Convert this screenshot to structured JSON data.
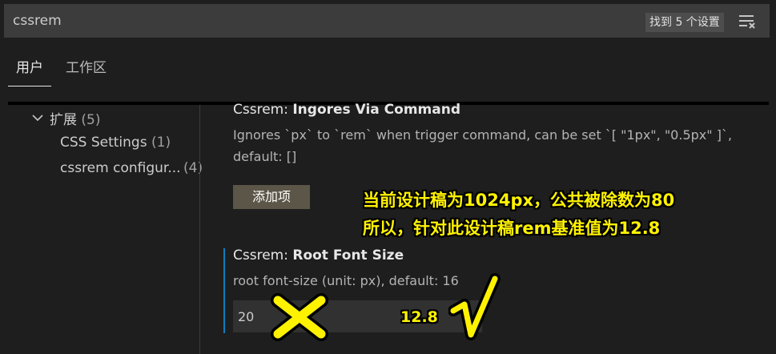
{
  "search": {
    "value": "cssrem",
    "result_badge": "找到 5 个设置",
    "filter_icon": "clear-filter-icon"
  },
  "tabs": [
    {
      "label": "用户",
      "active": true
    },
    {
      "label": "工作区",
      "active": false
    }
  ],
  "tree": {
    "group_label": "扩展",
    "group_count": "(5)",
    "items": [
      {
        "label": "CSS Settings",
        "count": "(1)"
      },
      {
        "label": "cssrem configur...",
        "count": "(4)"
      }
    ]
  },
  "settings": {
    "ingores": {
      "prefix": "Cssrem: ",
      "name": "Ingores Via Command",
      "desc_line1": "Ignores `px` to `rem` when trigger command, can be set `[ \"1px\", \"0.5px\" ]`,",
      "desc_line2": "default: []",
      "add_button": "添加项"
    },
    "root_font_size": {
      "prefix": "Cssrem: ",
      "name": "Root Font Size",
      "desc": "root font-size (unit: px), default: 16",
      "value": "20"
    }
  },
  "annotations": {
    "line1": "当前设计稿为1024px，公共被除数为80",
    "line2": "所以，针对此设计稿rem基准值为12.8",
    "correct_value": "12.8",
    "wrong_mark": "✕",
    "right_mark": "√"
  },
  "colors": {
    "background": "#1e1e1e",
    "accent_focus": "#0e7fc0",
    "annotation": "#fff200",
    "button": "#5c5648"
  }
}
